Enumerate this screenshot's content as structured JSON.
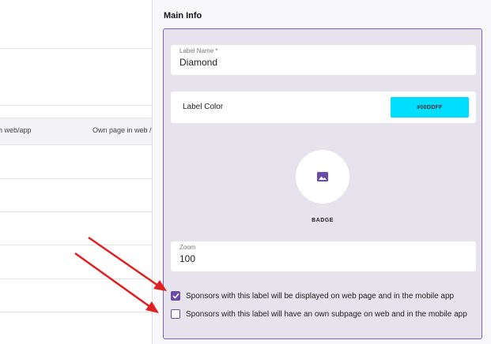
{
  "background_table": {
    "columns": [
      "n web/app",
      "Own page in web / a"
    ]
  },
  "drawer": {
    "section_title": "Main Info",
    "label_name": {
      "label": "Label Name *",
      "value": "Diamond"
    },
    "label_color": {
      "label": "Label Color",
      "value": "#00DDFF",
      "swatch_color": "#00ddff"
    },
    "badge": {
      "label": "BADGE",
      "icon": "image-icon"
    },
    "zoom": {
      "label": "Zoom",
      "value": "100"
    },
    "checkboxes": [
      {
        "label": "Sponsors with this label will be displayed on web page and in the mobile app",
        "checked": true
      },
      {
        "label": "Sponsors with this label will have an own subpage on web and in the mobile app",
        "checked": false
      }
    ]
  },
  "colors": {
    "accent": "#6b4aa8",
    "panel_border": "#7e62b6",
    "arrow": "#e02020"
  }
}
